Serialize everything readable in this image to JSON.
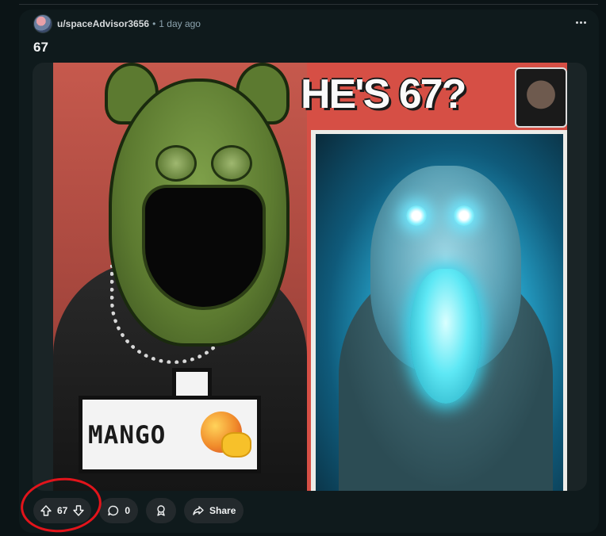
{
  "post": {
    "username": "u/spaceAdvisor3656",
    "separator": "•",
    "time": "1 day ago",
    "title": "67"
  },
  "image": {
    "heading_text": "HE'S 67?",
    "bubble_text": "MANGO"
  },
  "actions": {
    "upvotes": "67",
    "comments": "0",
    "share_label": "Share"
  },
  "colors": {
    "background": "#0b1416",
    "card": "#0f1a1c",
    "pill": "#23292c",
    "annotation": "#e2141b"
  },
  "icons": [
    "more-options-icon",
    "upvote-icon",
    "downvote-icon",
    "comment-icon",
    "award-icon",
    "share-icon"
  ]
}
